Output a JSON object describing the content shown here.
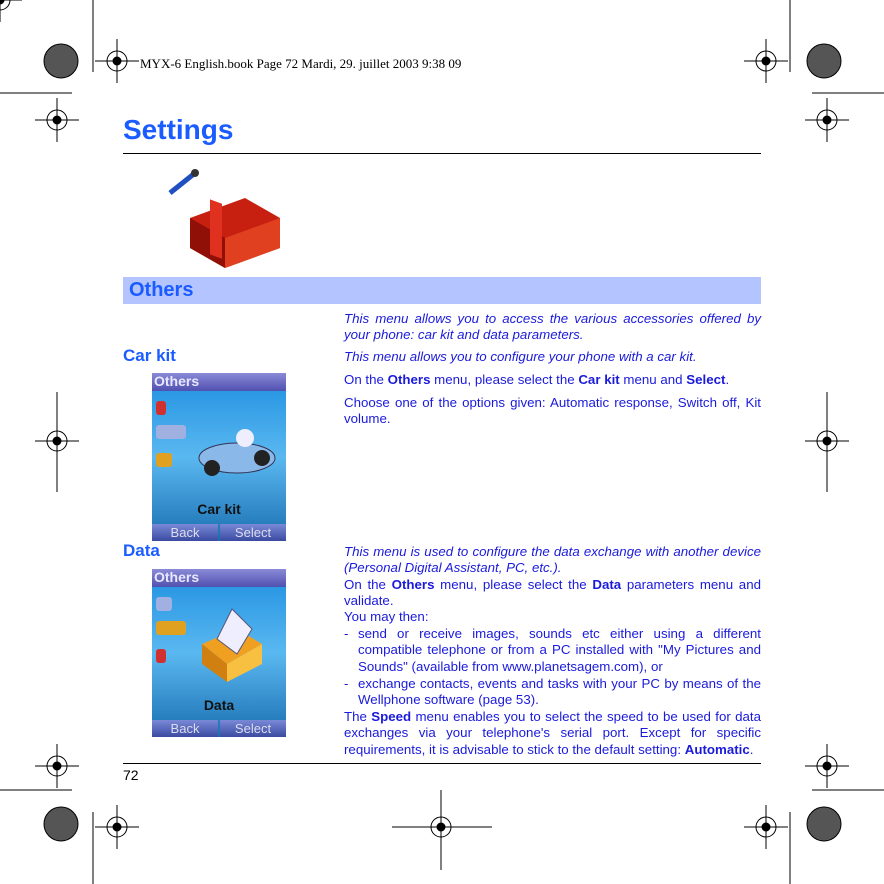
{
  "header_line": "MYX-6 English.book  Page 72  Mardi, 29. juillet 2003  9:38 09",
  "title": "Settings",
  "section": "Others",
  "intro": "This menu allows you to access the various accessories offered by your phone: car kit and data parameters.",
  "carkit": {
    "heading": "Car kit",
    "desc": "This menu allows you to configure your phone with a car kit.",
    "p1_a": "On the ",
    "p1_b": "Others",
    "p1_c": " menu, please select the ",
    "p1_d": "Car kit",
    "p1_e": " menu and ",
    "p1_f": "Select",
    "p1_g": ".",
    "p2": "Choose one of the options given: Automatic response, Switch off, Kit volume.",
    "screen": {
      "title": "Others",
      "label": "Car kit",
      "back": "Back",
      "select": "Select"
    }
  },
  "data": {
    "heading": "Data",
    "desc": "This menu is used to configure the data exchange with another device (Personal Digital Assistant, PC, etc.).",
    "p1_a": "On the ",
    "p1_b": "Others",
    "p1_c": " menu, please select the ",
    "p1_d": "Data",
    "p1_e": " parameters menu and validate.",
    "p2": "You may then:",
    "bullets": [
      "send or receive images, sounds etc either using a different compatible telephone or from a PC installed with \"My Pictures and Sounds\" (available from www.planetsagem.com), or",
      "exchange contacts, events and tasks with your PC by means of the Wellphone software (page 53)."
    ],
    "p3_a": "The ",
    "p3_b": "Speed",
    "p3_c": " menu enables you to select the speed to be used for data exchanges via your telephone's serial port. Except for specific requirements, it is advisable to stick to the default setting: ",
    "p3_d": "Automatic",
    "p3_e": ".",
    "screen": {
      "title": "Others",
      "label": "Data",
      "back": "Back",
      "select": "Select"
    }
  },
  "page_number": "72",
  "colors": {
    "heading": "#1a5cff",
    "text": "#1a1adc",
    "section_bar": "#b4c4ff"
  }
}
